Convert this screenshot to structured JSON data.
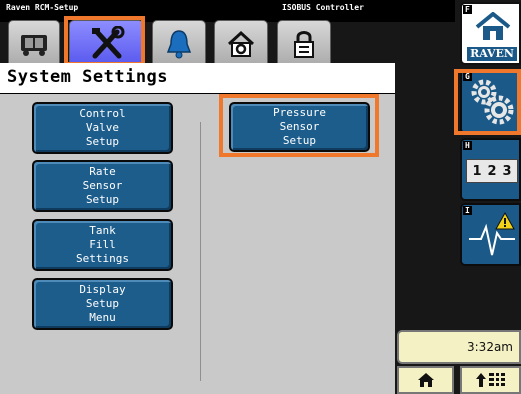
{
  "header": {
    "app_name": "Raven RCM-Setup",
    "controller_label": "ISOBUS Controller"
  },
  "tabs": [
    {
      "icon": "machine-icon"
    },
    {
      "icon": "tools-icon",
      "selected": true
    },
    {
      "icon": "bell-icon"
    },
    {
      "icon": "gear-house-icon"
    },
    {
      "icon": "padlock-icon"
    }
  ],
  "page": {
    "title": "System Settings"
  },
  "buttons": {
    "control_valve": "Control\nValve\nSetup",
    "rate_sensor": "Rate\nSensor\nSetup",
    "tank_fill": "Tank\nFill\nSettings",
    "display_setup": "Display\nSetup\nMenu",
    "pressure_sensor": "Pressure\nSensor\nSetup"
  },
  "softkeys": {
    "f": {
      "letter": "F",
      "label": "RAVEN",
      "icon": "home-icon"
    },
    "g": {
      "letter": "G",
      "icon": "gears-icon"
    },
    "h": {
      "letter": "H",
      "label": "123",
      "icon": "numeric-keypad-icon"
    },
    "i": {
      "letter": "I",
      "icon": "alarm-pulse-icon"
    }
  },
  "status": {
    "time": "3:32am"
  },
  "bottom": {
    "home_icon": "home-icon",
    "menu_icon": "up-arrow-grid-icon"
  },
  "colors": {
    "button_blue": "#1c5d8c",
    "highlight": "#f0782c",
    "active_tab": "#6666f5",
    "status_bg": "#f4f2c5"
  }
}
